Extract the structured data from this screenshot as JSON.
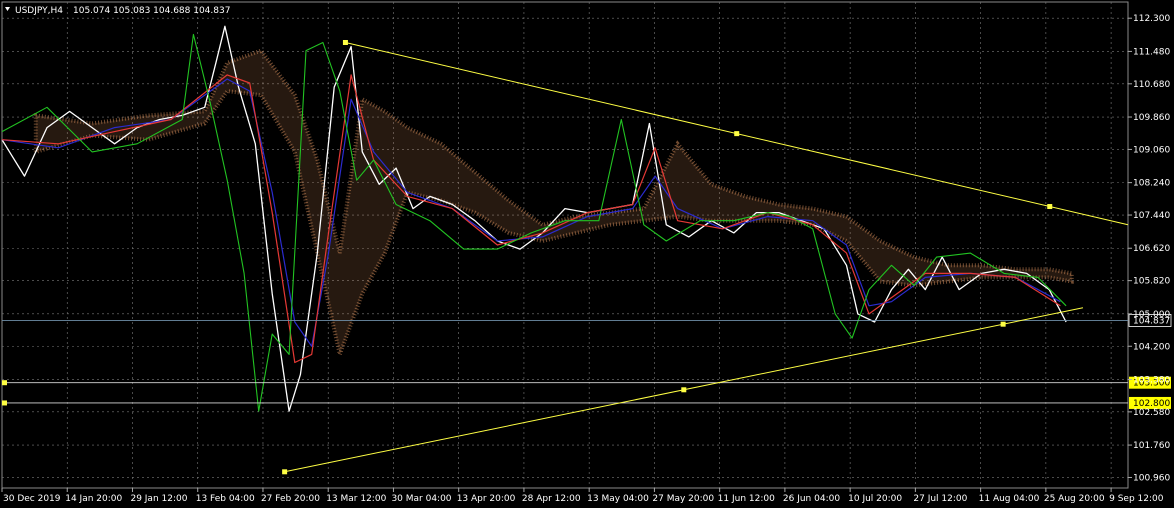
{
  "header": {
    "symbol_tf": "USDJPY,H4",
    "ohlc": "105.074 105.083 104.688 104.837"
  },
  "chart_data": {
    "type": "line",
    "title": "USDJPY,H4",
    "xlabel": "",
    "ylabel": "",
    "ylim": [
      100.7,
      112.7
    ],
    "yticks": [
      "112.300",
      "111.480",
      "110.680",
      "109.860",
      "109.060",
      "108.240",
      "107.440",
      "106.620",
      "105.820",
      "105.000",
      "104.200",
      "103.380",
      "102.580",
      "101.760",
      "100.960"
    ],
    "xticks": [
      "30 Dec 2019",
      "14 Jan 20:00",
      "29 Jan 12:00",
      "13 Feb 04:00",
      "27 Feb 20:00",
      "13 Mar 12:00",
      "30 Mar 04:00",
      "13 Apr 20:00",
      "28 Apr 12:00",
      "13 May 04:00",
      "27 May 20:00",
      "11 Jun 12:00",
      "26 Jun 04:00",
      "10 Jul 20:00",
      "27 Jul 12:00",
      "11 Aug 04:00",
      "25 Aug 20:00",
      "9 Sep 12:00"
    ],
    "grid": true,
    "price_line": {
      "label": "104.837",
      "value": 104.837
    },
    "horizontal_levels": [
      {
        "label": "103.300",
        "value": 103.3
      },
      {
        "label": "102.800",
        "value": 102.8
      }
    ],
    "trendlines": [
      {
        "name": "upper",
        "from": {
          "x": 0.305,
          "y": 111.7
        },
        "to": {
          "x": 1.0,
          "y": 107.2
        }
      },
      {
        "name": "lower",
        "from": {
          "x": 0.251,
          "y": 101.1
        },
        "to": {
          "x": 0.96,
          "y": 105.15
        }
      }
    ],
    "series": [
      {
        "name": "",
        "color": "#ffffff",
        "values": [
          [
            0.0,
            109.3
          ],
          [
            0.02,
            108.4
          ],
          [
            0.04,
            109.6
          ],
          [
            0.06,
            110.0
          ],
          [
            0.08,
            109.6
          ],
          [
            0.1,
            109.2
          ],
          [
            0.12,
            109.6
          ],
          [
            0.14,
            109.8
          ],
          [
            0.16,
            109.9
          ],
          [
            0.18,
            110.1
          ],
          [
            0.19,
            111.2
          ],
          [
            0.198,
            112.1
          ],
          [
            0.21,
            110.6
          ],
          [
            0.225,
            109.2
          ],
          [
            0.24,
            105.5
          ],
          [
            0.255,
            102.6
          ],
          [
            0.265,
            103.5
          ],
          [
            0.28,
            106.5
          ],
          [
            0.295,
            110.6
          ],
          [
            0.31,
            111.6
          ],
          [
            0.32,
            109.0
          ],
          [
            0.335,
            108.2
          ],
          [
            0.35,
            108.6
          ],
          [
            0.365,
            107.6
          ],
          [
            0.38,
            107.9
          ],
          [
            0.4,
            107.7
          ],
          [
            0.42,
            107.3
          ],
          [
            0.44,
            106.8
          ],
          [
            0.46,
            106.6
          ],
          [
            0.48,
            107.0
          ],
          [
            0.5,
            107.6
          ],
          [
            0.52,
            107.5
          ],
          [
            0.54,
            107.6
          ],
          [
            0.56,
            107.7
          ],
          [
            0.575,
            109.7
          ],
          [
            0.59,
            107.2
          ],
          [
            0.61,
            106.9
          ],
          [
            0.63,
            107.3
          ],
          [
            0.65,
            107.0
          ],
          [
            0.67,
            107.5
          ],
          [
            0.69,
            107.5
          ],
          [
            0.71,
            107.3
          ],
          [
            0.73,
            107.1
          ],
          [
            0.75,
            106.2
          ],
          [
            0.76,
            105.0
          ],
          [
            0.775,
            104.8
          ],
          [
            0.79,
            105.6
          ],
          [
            0.805,
            106.1
          ],
          [
            0.82,
            105.6
          ],
          [
            0.835,
            106.4
          ],
          [
            0.85,
            105.6
          ],
          [
            0.87,
            106.0
          ],
          [
            0.89,
            106.1
          ],
          [
            0.91,
            106.0
          ],
          [
            0.93,
            105.6
          ],
          [
            0.945,
            104.8
          ]
        ]
      },
      {
        "name": "",
        "color": "#2b2bcf",
        "values": [
          [
            0.0,
            109.3
          ],
          [
            0.05,
            109.1
          ],
          [
            0.1,
            109.6
          ],
          [
            0.15,
            109.8
          ],
          [
            0.2,
            110.8
          ],
          [
            0.22,
            110.5
          ],
          [
            0.24,
            108.0
          ],
          [
            0.26,
            104.8
          ],
          [
            0.275,
            104.2
          ],
          [
            0.29,
            106.5
          ],
          [
            0.31,
            110.3
          ],
          [
            0.33,
            109.0
          ],
          [
            0.36,
            108.0
          ],
          [
            0.4,
            107.6
          ],
          [
            0.44,
            106.8
          ],
          [
            0.48,
            106.9
          ],
          [
            0.52,
            107.4
          ],
          [
            0.56,
            107.6
          ],
          [
            0.58,
            108.4
          ],
          [
            0.6,
            107.6
          ],
          [
            0.64,
            107.1
          ],
          [
            0.68,
            107.4
          ],
          [
            0.72,
            107.3
          ],
          [
            0.75,
            106.7
          ],
          [
            0.77,
            105.2
          ],
          [
            0.79,
            105.3
          ],
          [
            0.82,
            105.9
          ],
          [
            0.86,
            106.0
          ],
          [
            0.9,
            105.9
          ],
          [
            0.94,
            105.3
          ]
        ]
      },
      {
        "name": "",
        "color": "#e53935",
        "values": [
          [
            0.0,
            109.3
          ],
          [
            0.05,
            109.2
          ],
          [
            0.1,
            109.5
          ],
          [
            0.15,
            109.8
          ],
          [
            0.2,
            110.9
          ],
          [
            0.22,
            110.7
          ],
          [
            0.24,
            107.5
          ],
          [
            0.26,
            103.8
          ],
          [
            0.275,
            104.0
          ],
          [
            0.29,
            107.0
          ],
          [
            0.31,
            110.9
          ],
          [
            0.33,
            108.8
          ],
          [
            0.36,
            107.9
          ],
          [
            0.4,
            107.6
          ],
          [
            0.44,
            106.7
          ],
          [
            0.48,
            107.0
          ],
          [
            0.52,
            107.5
          ],
          [
            0.56,
            107.7
          ],
          [
            0.58,
            109.1
          ],
          [
            0.6,
            107.3
          ],
          [
            0.64,
            107.1
          ],
          [
            0.68,
            107.5
          ],
          [
            0.72,
            107.2
          ],
          [
            0.75,
            106.5
          ],
          [
            0.77,
            105.0
          ],
          [
            0.79,
            105.4
          ],
          [
            0.82,
            106.0
          ],
          [
            0.86,
            106.0
          ],
          [
            0.9,
            105.9
          ],
          [
            0.94,
            105.2
          ]
        ]
      },
      {
        "name": "",
        "color": "#22c322",
        "values": [
          [
            0.0,
            109.5
          ],
          [
            0.04,
            110.1
          ],
          [
            0.08,
            109.0
          ],
          [
            0.12,
            109.2
          ],
          [
            0.16,
            109.8
          ],
          [
            0.17,
            111.9
          ],
          [
            0.185,
            110.2
          ],
          [
            0.2,
            108.3
          ],
          [
            0.215,
            106.0
          ],
          [
            0.228,
            102.6
          ],
          [
            0.24,
            104.5
          ],
          [
            0.255,
            104.0
          ],
          [
            0.27,
            111.5
          ],
          [
            0.285,
            111.7
          ],
          [
            0.3,
            110.5
          ],
          [
            0.315,
            108.3
          ],
          [
            0.33,
            108.8
          ],
          [
            0.35,
            107.7
          ],
          [
            0.38,
            107.3
          ],
          [
            0.41,
            106.6
          ],
          [
            0.44,
            106.6
          ],
          [
            0.47,
            107.0
          ],
          [
            0.5,
            107.3
          ],
          [
            0.53,
            107.3
          ],
          [
            0.55,
            109.8
          ],
          [
            0.57,
            107.2
          ],
          [
            0.59,
            106.8
          ],
          [
            0.62,
            107.3
          ],
          [
            0.65,
            107.3
          ],
          [
            0.68,
            107.5
          ],
          [
            0.7,
            107.4
          ],
          [
            0.72,
            107.1
          ],
          [
            0.74,
            105.0
          ],
          [
            0.755,
            104.4
          ],
          [
            0.77,
            105.6
          ],
          [
            0.79,
            106.2
          ],
          [
            0.81,
            105.7
          ],
          [
            0.83,
            106.4
          ],
          [
            0.86,
            106.5
          ],
          [
            0.89,
            106.0
          ],
          [
            0.92,
            105.9
          ],
          [
            0.945,
            105.2
          ]
        ]
      }
    ],
    "cloud": {
      "color": "#d08a5a",
      "values": [
        [
          0.03,
          109.0,
          109.9
        ],
        [
          0.08,
          109.4,
          109.7
        ],
        [
          0.13,
          109.3,
          109.9
        ],
        [
          0.18,
          109.7,
          110.0
        ],
        [
          0.2,
          110.5,
          111.2
        ],
        [
          0.23,
          110.4,
          111.5
        ],
        [
          0.26,
          109.0,
          110.4
        ],
        [
          0.28,
          106.5,
          108.8
        ],
        [
          0.3,
          104.0,
          106.5
        ],
        [
          0.32,
          105.5,
          110.3
        ],
        [
          0.34,
          106.5,
          110.0
        ],
        [
          0.36,
          108.0,
          109.6
        ],
        [
          0.39,
          107.8,
          109.2
        ],
        [
          0.42,
          107.5,
          108.5
        ],
        [
          0.45,
          107.0,
          107.8
        ],
        [
          0.48,
          106.8,
          107.2
        ],
        [
          0.51,
          107.0,
          107.4
        ],
        [
          0.54,
          107.2,
          107.5
        ],
        [
          0.57,
          107.3,
          107.6
        ],
        [
          0.6,
          107.4,
          109.2
        ],
        [
          0.63,
          107.3,
          108.2
        ],
        [
          0.66,
          107.3,
          107.9
        ],
        [
          0.69,
          107.3,
          107.7
        ],
        [
          0.72,
          107.2,
          107.6
        ],
        [
          0.75,
          106.8,
          107.4
        ],
        [
          0.78,
          105.8,
          106.8
        ],
        [
          0.81,
          105.7,
          106.4
        ],
        [
          0.84,
          105.8,
          106.2
        ],
        [
          0.87,
          105.9,
          106.2
        ],
        [
          0.9,
          105.9,
          106.1
        ],
        [
          0.93,
          105.9,
          106.1
        ],
        [
          0.95,
          105.8,
          106.0
        ]
      ]
    }
  }
}
